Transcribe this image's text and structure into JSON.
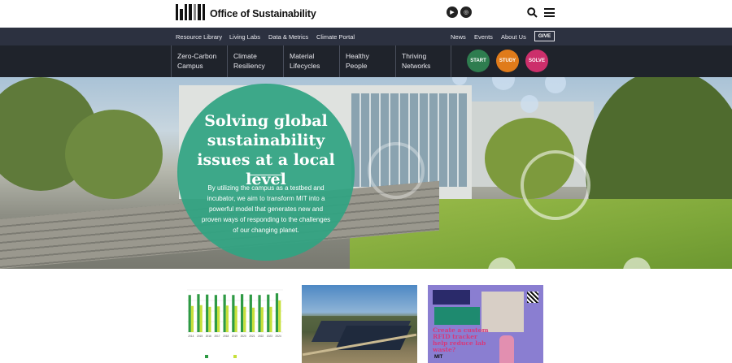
{
  "header": {
    "site_title": "Office of Sustainability",
    "logo_name": "mit-logo",
    "social": [
      {
        "name": "youtube-icon",
        "glyph": "▶"
      },
      {
        "name": "instagram-icon",
        "glyph": "◎"
      }
    ]
  },
  "topnav": {
    "left": [
      "Resource Library",
      "Living Labs",
      "Data & Metrics",
      "Climate Portal"
    ],
    "right": [
      "News",
      "Events",
      "About Us"
    ],
    "give": "GIVE"
  },
  "themes": [
    {
      "line1": "Zero-Carbon",
      "line2": "Campus"
    },
    {
      "line1": "Climate",
      "line2": "Resiliency"
    },
    {
      "line1": "Material",
      "line2": "Lifecycles"
    },
    {
      "line1": "Healthy",
      "line2": "People"
    },
    {
      "line1": "Thriving",
      "line2": "Networks"
    }
  ],
  "actions": [
    {
      "label": "START",
      "color": "#2e7d4f"
    },
    {
      "label": "STUDY",
      "color": "#e07b1a"
    },
    {
      "label": "SOLVE",
      "color": "#cc2f6b"
    }
  ],
  "hero": {
    "title": "Solving global sustainability issues at a local level",
    "body": "By utilizing the campus as a testbed and incubator, we aim to transform MIT into a powerful model that generates new and proven ways of responding to the challenges of our changing planet.",
    "circle_color": "#30a482"
  },
  "cards": {
    "chart": {
      "chart_data": {
        "type": "bar",
        "categories": [
          "2014",
          "2015",
          "2016",
          "2017",
          "2018",
          "2019",
          "2020",
          "2021",
          "2022",
          "2023",
          "2024"
        ],
        "series": [
          {
            "name": "",
            "values": [
              88,
              90,
              89,
              88,
              89,
              88,
              90,
              89,
              88,
              89,
              92
            ],
            "color": "#2e9a44"
          },
          {
            "name": "",
            "values": [
              62,
              64,
              60,
              61,
              63,
              62,
              60,
              58,
              59,
              60,
              75
            ],
            "color": "#c6e03a"
          }
        ],
        "title": "",
        "xlabel": "",
        "ylabel": "",
        "ylim": [
          0,
          100
        ]
      }
    },
    "promo": {
      "title": "Create a custom RFID tracker help reduce lab waste?",
      "footer": "MIT"
    }
  }
}
